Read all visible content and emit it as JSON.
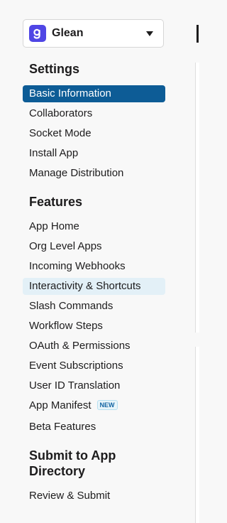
{
  "app_selector": {
    "name": "Glean",
    "icon": "glean-logo-icon"
  },
  "sections": {
    "settings": "Settings",
    "features": "Features",
    "submit": "Submit to App Directory"
  },
  "settings_items": [
    "Basic Information",
    "Collaborators",
    "Socket Mode",
    "Install App",
    "Manage Distribution"
  ],
  "features_items": [
    "App Home",
    "Org Level Apps",
    "Incoming Webhooks",
    "Interactivity & Shortcuts",
    "Slash Commands",
    "Workflow Steps",
    "OAuth & Permissions",
    "Event Subscriptions",
    "User ID Translation",
    "App Manifest",
    "Beta Features"
  ],
  "badges": {
    "app_manifest": "NEW"
  },
  "submit_items": [
    "Review & Submit"
  ],
  "colors": {
    "active_bg": "#0d5c96",
    "hover_bg": "#e3f0f7",
    "app_icon": "#4f46e5"
  }
}
